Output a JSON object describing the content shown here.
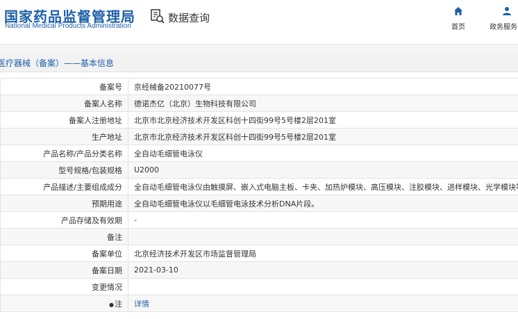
{
  "header": {
    "logo_cn": "国家药品监督管理局",
    "logo_en": "National Medical Products Administration",
    "query_label": "数据查询",
    "nav": [
      {
        "label": "首页",
        "icon": "home-icon"
      },
      {
        "label": "政务服务门",
        "icon": "user-icon"
      }
    ]
  },
  "section_title": "医疗器械（备案）——基本信息",
  "rows": [
    {
      "key": "备案号",
      "value": "京经械备20210077号"
    },
    {
      "key": "备案人名称",
      "value": "德诺杰亿（北京）生物科技有限公司"
    },
    {
      "key": "备案人注册地址",
      "value": "北京市北京经济技术开发区科创十四街99号5号楼2层201室"
    },
    {
      "key": "生产地址",
      "value": "北京市北京经济技术开发区科创十四街99号5号楼2层201室"
    },
    {
      "key": "产品名称/产品分类名称",
      "value": "全自动毛细管电泳仪"
    },
    {
      "key": "型号规格/包装规格",
      "value": "U2000"
    },
    {
      "key": "产品描述/主要组成成分",
      "value": "全自动毛细管电泳仪由触摸屏、嵌入式电脑主板、卡夹、加热炉模块、高压模块、注胶模块、进样模块、光学模块等模块组成。"
    },
    {
      "key": "预期用途",
      "value": "全自动毛细管电泳仪以毛细管电泳技术分析DNA片段。"
    },
    {
      "key": "产品存储及有效期",
      "value": "-"
    },
    {
      "key": "备注",
      "value": ""
    },
    {
      "key": "备案单位",
      "value": "北京经济技术开发区市场监督管理局"
    },
    {
      "key": "备案日期",
      "value": "2021-03-10"
    },
    {
      "key": "变更情况",
      "value": ""
    },
    {
      "key": "注",
      "value": "详情",
      "is_link": true
    }
  ]
}
